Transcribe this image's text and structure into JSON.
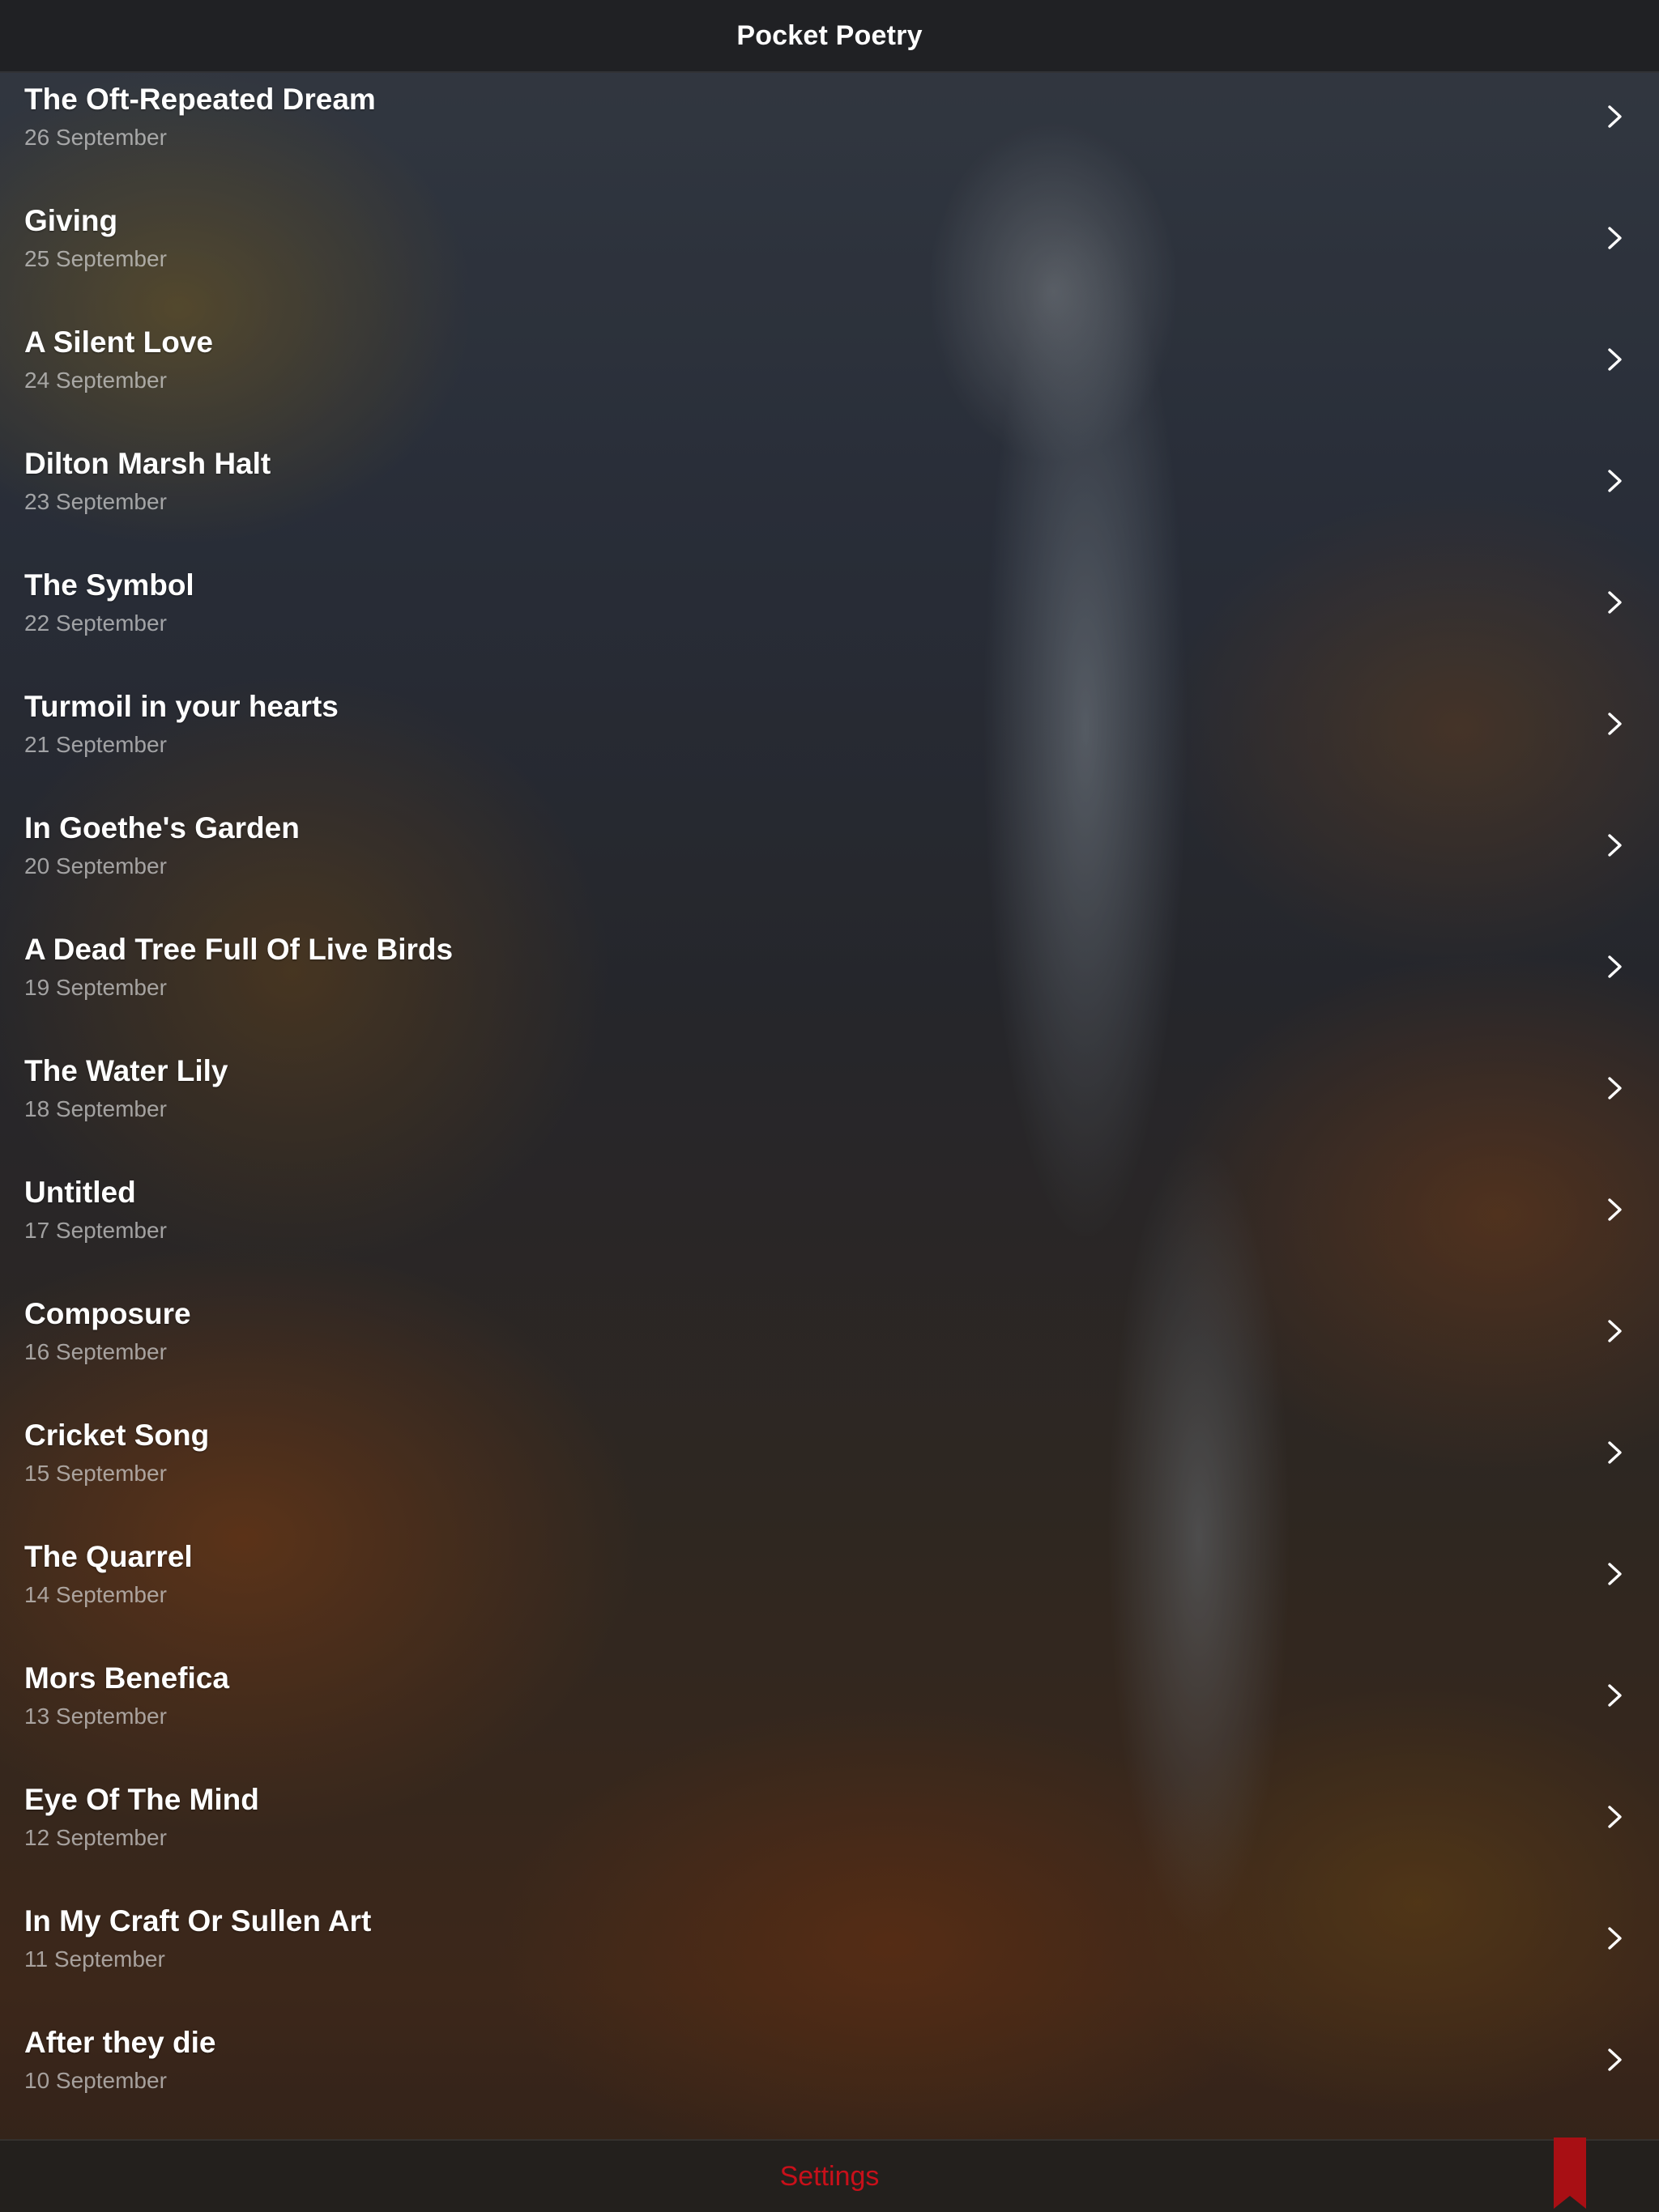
{
  "navbar": {
    "title": "Pocket Poetry"
  },
  "poems": [
    {
      "title": "The Oft-Repeated Dream",
      "date": "26 September"
    },
    {
      "title": "Giving",
      "date": "25 September"
    },
    {
      "title": "A Silent Love",
      "date": "24 September"
    },
    {
      "title": "Dilton Marsh Halt",
      "date": "23 September"
    },
    {
      "title": "The Symbol",
      "date": "22 September"
    },
    {
      "title": "Turmoil in your hearts",
      "date": "21 September"
    },
    {
      "title": "In Goethe's Garden",
      "date": "20 September"
    },
    {
      "title": "A Dead Tree Full Of Live Birds",
      "date": "19 September"
    },
    {
      "title": "The Water Lily",
      "date": "18 September"
    },
    {
      "title": "Untitled",
      "date": "17 September"
    },
    {
      "title": "Composure",
      "date": "16 September"
    },
    {
      "title": "Cricket Song",
      "date": "15 September"
    },
    {
      "title": "The Quarrel",
      "date": "14 September"
    },
    {
      "title": "Mors Benefica",
      "date": "13 September"
    },
    {
      "title": "Eye Of The Mind",
      "date": "12 September"
    },
    {
      "title": "In My Craft Or Sullen Art",
      "date": "11 September"
    },
    {
      "title": "After they die",
      "date": "10 September"
    }
  ],
  "toolbar": {
    "settings_label": "Settings",
    "bookmark_icon": "bookmark-icon",
    "accent_color": "#c8101a"
  },
  "icons": {
    "row_disclosure": "chevron-right-icon"
  }
}
